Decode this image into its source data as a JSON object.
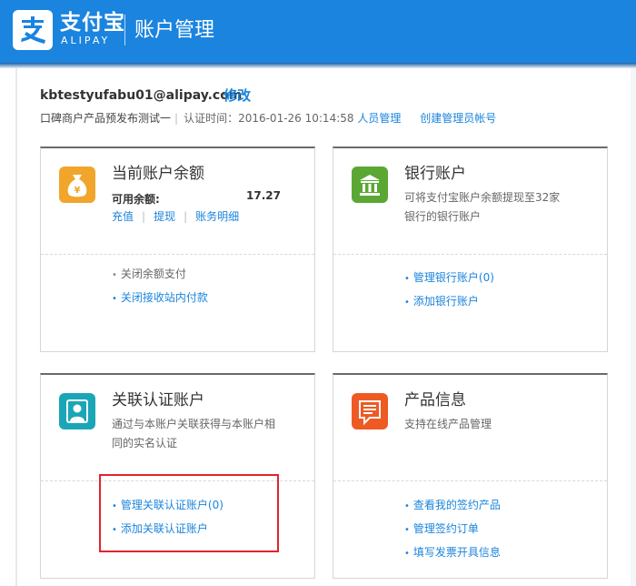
{
  "header": {
    "brand_cn": "支付宝",
    "brand_en": "ALIPAY",
    "title": "账户管理",
    "color": "#1a84df"
  },
  "account": {
    "email": "kbtestyufabu01@alipay.com",
    "edit_label": "修改",
    "merchant_name": "口碑商户产品预发布测试一",
    "cert_time": "认证时间：2016-01-26 10:14:58",
    "staff_manage": "人员管理",
    "create_admin": "创建管理员帐号"
  },
  "cards": {
    "balance": {
      "title": "当前账户余额",
      "icon": "money-bag-icon",
      "icon_color": "#f2a52b",
      "available_label": "可用余额:",
      "available_value": "17.27",
      "actions": [
        "充值",
        "提现",
        "账务明细"
      ],
      "items": [
        "关闭余额支付",
        "关闭接收站内付款"
      ]
    },
    "bank": {
      "title": "银行账户",
      "icon": "bank-icon",
      "icon_color": "#5aa833",
      "desc": "可将支付宝账户余额提现至32家银行的银行账户",
      "items": [
        "管理银行账户(0)",
        "添加银行账户"
      ]
    },
    "linked": {
      "title": "关联认证账户",
      "icon": "user-icon",
      "icon_color": "#1aa6b7",
      "desc": "通过与本账户关联获得与本账户相同的实名认证",
      "items": [
        "管理关联认证账户(0)",
        "添加关联认证账户"
      ]
    },
    "product": {
      "title": "产品信息",
      "icon": "message-icon",
      "icon_color": "#ee5a24",
      "desc": "支持在线产品管理",
      "items": [
        "查看我的签约产品",
        "管理签约订单",
        "填写发票开具信息"
      ]
    }
  },
  "highlight_color": "#e0232f"
}
